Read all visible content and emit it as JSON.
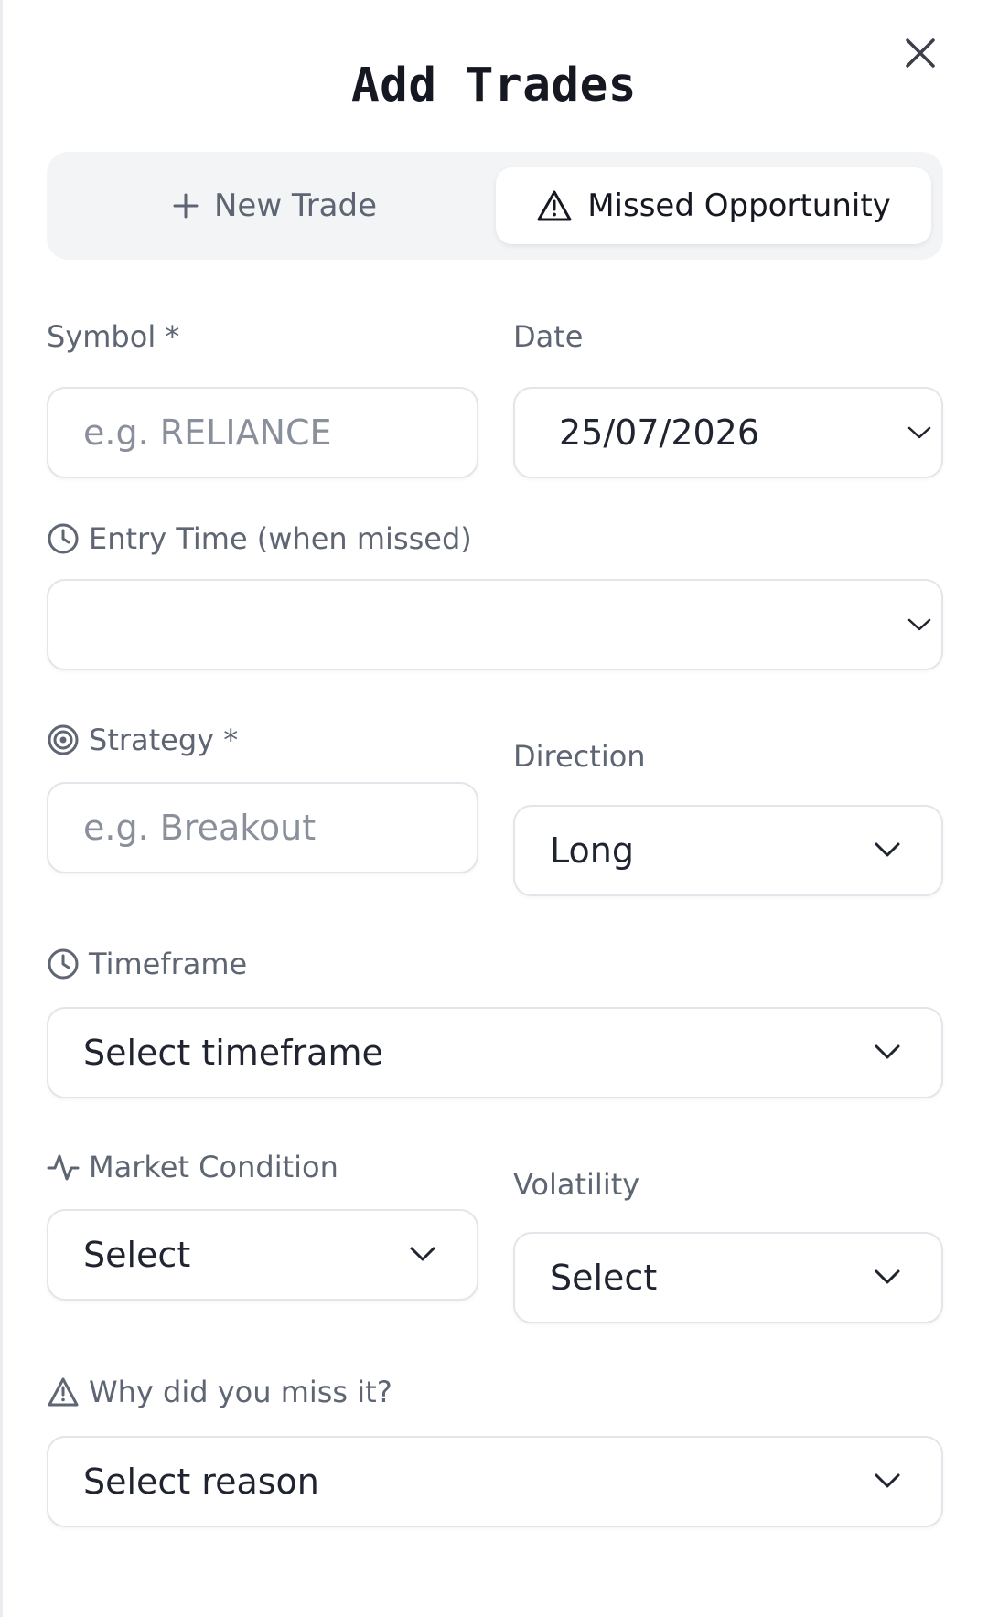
{
  "modal": {
    "title": "Add Trades",
    "close_icon": "close-icon"
  },
  "mode_tabs": {
    "new_trade": {
      "label": "New Trade",
      "icon": "plus-icon",
      "selected": false
    },
    "missed_opportunity": {
      "label": "Missed Opportunity",
      "icon": "warning-triangle-icon",
      "selected": true
    }
  },
  "form": {
    "symbol": {
      "label": "Symbol *",
      "placeholder": "e.g. RELIANCE",
      "value": ""
    },
    "date": {
      "label": "Date",
      "value": "25/07/2026"
    },
    "entry_time": {
      "label": "Entry Time (when missed)",
      "icon": "clock-icon",
      "value": ""
    },
    "strategy": {
      "label": "Strategy *",
      "icon": "target-icon",
      "placeholder": "e.g. Breakout",
      "value": ""
    },
    "direction": {
      "label": "Direction",
      "value": "Long"
    },
    "timeframe": {
      "label": "Timeframe",
      "icon": "clock-icon",
      "value": "Select timeframe"
    },
    "market_condition": {
      "label": "Market Condition",
      "icon": "activity-icon",
      "value": "Select"
    },
    "volatility": {
      "label": "Volatility",
      "value": "Select"
    },
    "miss_reason": {
      "label": "Why did you miss it?",
      "icon": "warning-triangle-icon",
      "value": "Select reason"
    }
  },
  "colors": {
    "label": "#5e6573",
    "text": "#1f2430",
    "placeholder": "#8a909b",
    "border": "#e3e5ea",
    "tab_track": "#f3f4f6"
  }
}
